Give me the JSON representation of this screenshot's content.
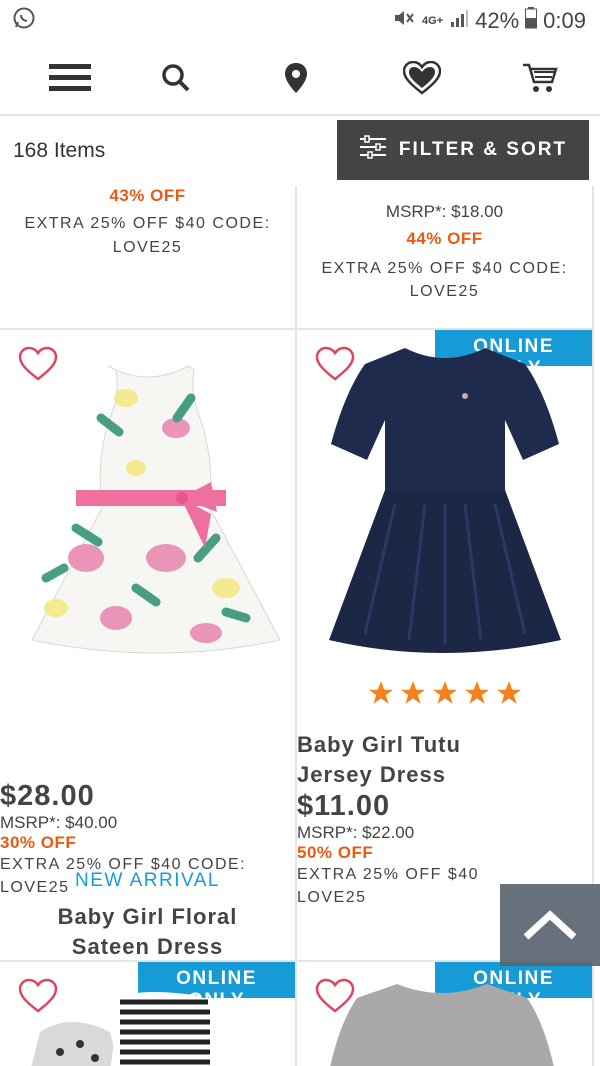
{
  "status_bar": {
    "network": "4G+",
    "battery": "42%",
    "time": "0:09",
    "icons": [
      "whatsapp-icon",
      "mute-icon",
      "signal-icon",
      "battery-icon"
    ]
  },
  "nav": {
    "icons": [
      "menu-icon",
      "search-icon",
      "location-icon",
      "heart-icon",
      "cart-icon"
    ]
  },
  "toolbar": {
    "item_count": "168 Items",
    "filter_label": "FILTER & SORT"
  },
  "products": [
    {
      "discount": "43% OFF",
      "promo_line1": "EXTRA 25% OFF $40 CODE:",
      "promo_line2": "LOVE25"
    },
    {
      "msrp": "MSRP*: $18.00",
      "discount": "44% OFF",
      "promo_line1": "EXTRA 25% OFF $40 CODE:",
      "promo_line2": "LOVE25"
    },
    {
      "tag": "NEW ARRIVAL",
      "name_line1": "Baby Girl Floral",
      "name_line2": "Sateen Dress",
      "price": "$28.00",
      "msrp": "MSRP*: $40.00",
      "discount": "30% OFF",
      "promo_line1": "EXTRA 25% OFF $40 CODE:",
      "promo_line2": "LOVE25"
    },
    {
      "badge": "ONLINE ONLY",
      "rating": 5,
      "name_line1": "Baby Girl Tutu",
      "name_line2": "Jersey Dress",
      "price": "$11.00",
      "msrp": "MSRP*: $22.00",
      "discount": "50% OFF",
      "promo_line1": "EXTRA 25% OFF $40",
      "promo_line2": "LOVE25"
    },
    {
      "badge": "ONLINE ONLY"
    },
    {
      "badge": "ONLINE ONLY"
    }
  ],
  "colors": {
    "accent_blue": "#179bd7",
    "discount_orange": "#e95b12",
    "star_orange": "#f58220",
    "filter_bg": "#444444",
    "dress_navy": "#1f2b4d"
  }
}
